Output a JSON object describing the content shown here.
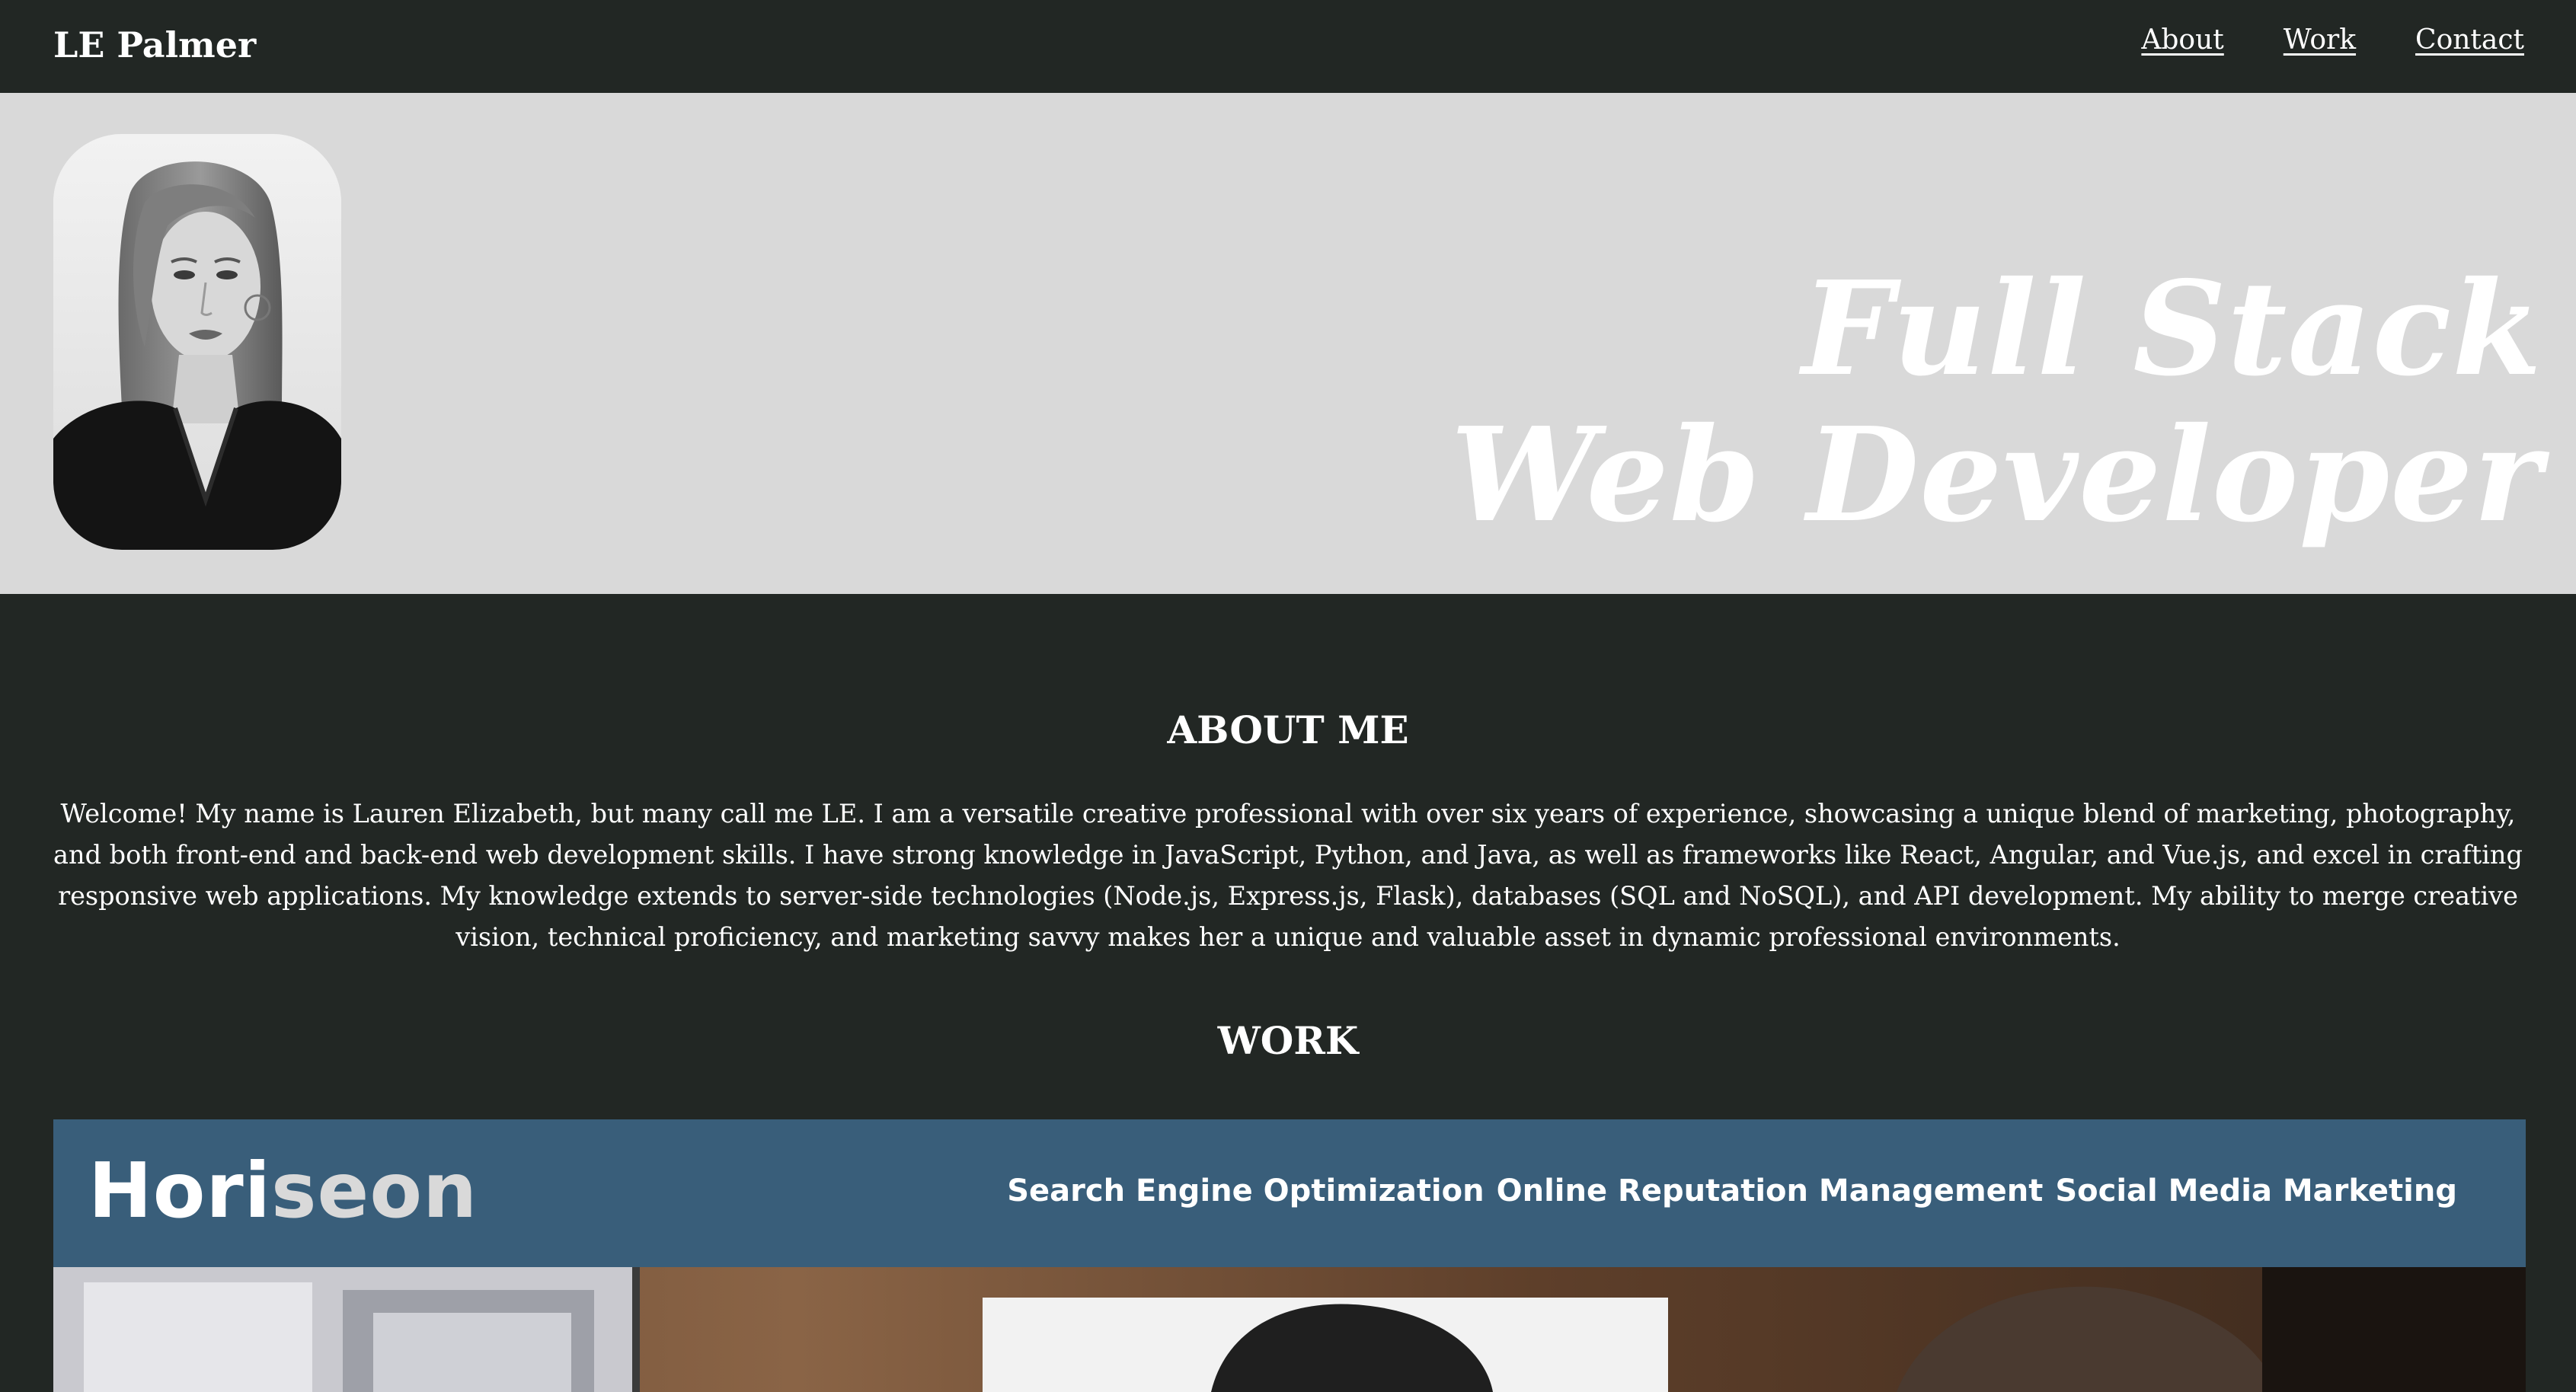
{
  "header": {
    "brand": "LE Palmer",
    "nav": [
      "About",
      "Work",
      "Contact"
    ]
  },
  "hero": {
    "title_line1": "Full Stack",
    "title_line2": "Web Developer",
    "portrait_icon": "portrait-photo"
  },
  "about": {
    "heading": "ABOUT ME",
    "body": "Welcome! My name is Lauren Elizabeth, but many call me LE. I am a versatile creative professional with over six years of experience, showcasing a unique blend of marketing, photography, and both front-end and back-end web development skills. I have strong knowledge in JavaScript, Python, and Java, as well as frameworks like React, Angular, and Vue.js, and excel in crafting responsive web applications. My knowledge extends to server-side technologies (Node.js, Express.js, Flask), databases (SQL and NoSQL), and API development. My ability to merge creative vision, technical proficiency, and marketing savvy makes her a unique and valuable asset in dynamic professional environments."
  },
  "work": {
    "heading": "WORK",
    "project": {
      "logo_part1": "Hori",
      "logo_part2": "seon",
      "nav": [
        "Search Engine Optimization",
        "Online Reputation Management",
        "Social Media Marketing"
      ]
    }
  },
  "colors": {
    "header_bg": "#222724",
    "hero_bg": "#d9d9d9",
    "project_header_bg": "#395e7a",
    "text": "#ffffff"
  }
}
